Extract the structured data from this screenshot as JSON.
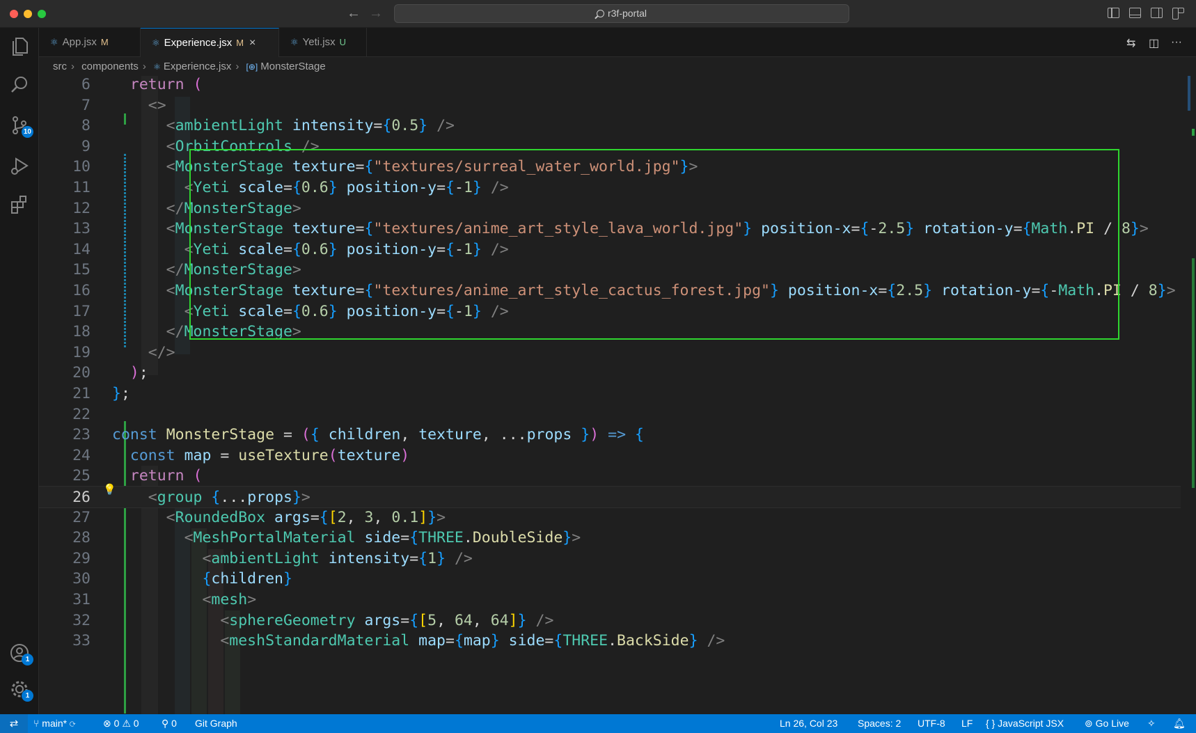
{
  "window": {
    "title": "r3f-portal"
  },
  "tabs": [
    {
      "label": "App.jsx",
      "status": "M",
      "active": false
    },
    {
      "label": "Experience.jsx",
      "status": "M",
      "active": true,
      "close": "×"
    },
    {
      "label": "Yeti.jsx",
      "status": "U",
      "active": false
    }
  ],
  "breadcrumb": [
    "src",
    "components",
    "Experience.jsx",
    "MonsterStage"
  ],
  "activity_badges": {
    "source_control": "10",
    "accounts": "1",
    "manage": "1"
  },
  "editor": {
    "current_line": 26,
    "line_numbers": [
      "6",
      "7",
      "8",
      "9",
      "10",
      "11",
      "12",
      "13",
      "14",
      "15",
      "16",
      "17",
      "18",
      "19",
      "20",
      "21",
      "22",
      "23",
      "24",
      "25",
      "26",
      "27",
      "28",
      "29",
      "30",
      "31",
      "32",
      "33"
    ],
    "lines": [
      "  return (",
      "    <>",
      "      <ambientLight intensity={0.5} />",
      "      <OrbitControls />",
      "      <MonsterStage texture={\"textures/surreal_water_world.jpg\"}>",
      "        <Yeti scale={0.6} position-y={-1} />",
      "      </MonsterStage>",
      "      <MonsterStage texture={\"textures/anime_art_style_lava_world.jpg\"} position-x={-2.5} rotation-y={Math.PI / 8}>",
      "        <Yeti scale={0.6} position-y={-1} />",
      "      </MonsterStage>",
      "      <MonsterStage texture={\"textures/anime_art_style_cactus_forest.jpg\"} position-x={2.5} rotation-y={-Math.PI / 8}>",
      "        <Yeti scale={0.6} position-y={-1} />",
      "      </MonsterStage>",
      "    </>",
      "  );",
      "};",
      "",
      "const MonsterStage = ({ children, texture, ...props }) => {",
      "  const map = useTexture(texture)",
      "  return (",
      "    <group {...props}>",
      "      <RoundedBox args={[2, 3, 0.1]}>",
      "        <MeshPortalMaterial side={THREE.DoubleSide}>",
      "          <ambientLight intensity={1} />",
      "          {children}",
      "          <mesh>",
      "            <sphereGeometry args={[5, 64, 64]} />",
      "            <meshStandardMaterial map={map} side={THREE.BackSide} />"
    ]
  },
  "statusbar": {
    "branch": "main*",
    "errors": "0",
    "warnings": "0",
    "ports": "0",
    "git_graph": "Git Graph",
    "position": "Ln 26, Col 23",
    "spaces": "Spaces: 2",
    "encoding": "UTF-8",
    "eol": "LF",
    "language": "JavaScript JSX",
    "go_live": "Go Live"
  },
  "colors": {
    "accent": "#0078d4",
    "highlight_box": "#2fd62f",
    "editor_bg": "#1f1f1f"
  },
  "icons": [
    "files-icon",
    "search-icon",
    "source-control-icon",
    "run-debug-icon",
    "extensions-icon",
    "accounts-icon",
    "gear-icon",
    "lightbulb-icon",
    "branch-icon",
    "sync-icon",
    "error-icon",
    "warning-icon",
    "ports-icon",
    "bell-icon"
  ]
}
